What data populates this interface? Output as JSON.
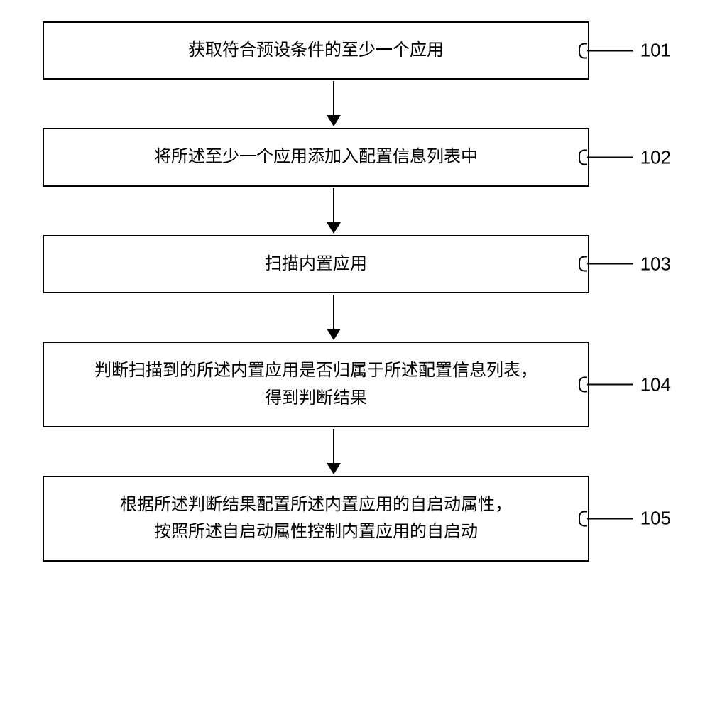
{
  "flowchart": {
    "steps": [
      {
        "id": "101",
        "text": "获取符合预设条件的至少一个应用",
        "height": "short"
      },
      {
        "id": "102",
        "text": "将所述至少一个应用添加入配置信息列表中",
        "height": "short"
      },
      {
        "id": "103",
        "text": "扫描内置应用",
        "height": "short"
      },
      {
        "id": "104",
        "text": "判断扫描到的所述内置应用是否归属于所述配置信息列表，\n得到判断结果",
        "height": "tall"
      },
      {
        "id": "105",
        "text": "根据所述判断结果配置所述内置应用的自启动属性，\n按照所述自启动属性控制内置应用的自启动",
        "height": "tall"
      }
    ]
  }
}
